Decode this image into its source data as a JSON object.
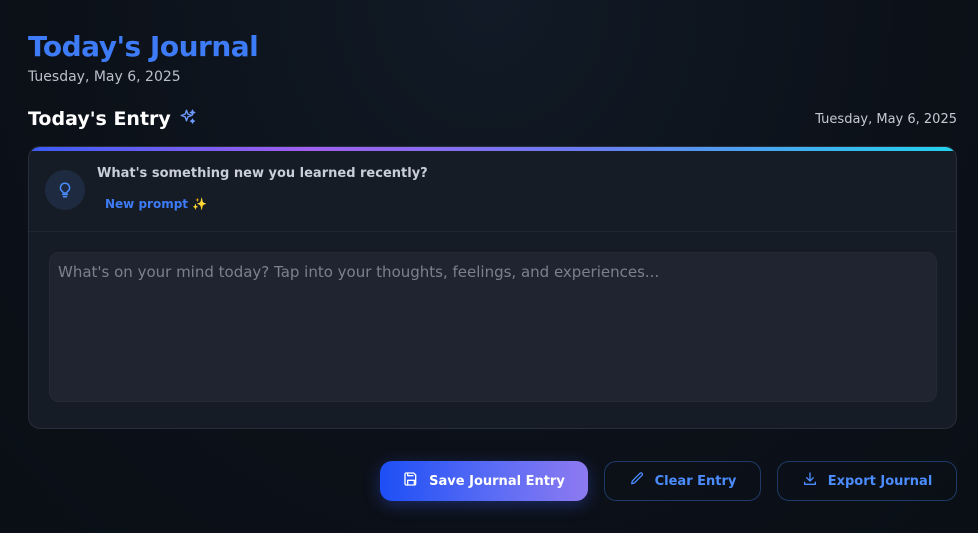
{
  "header": {
    "title": "Today's Journal",
    "date": "Tuesday, May 6, 2025"
  },
  "entry_section": {
    "title": "Today's Entry",
    "title_icon": "sparkles-icon",
    "date": "Tuesday, May 6, 2025"
  },
  "prompt": {
    "icon": "lightbulb-icon",
    "question": "What's something new you learned recently?",
    "new_prompt_label": "New prompt",
    "new_prompt_emoji": "✨"
  },
  "editor": {
    "value": "",
    "placeholder": "What's on your mind today? Tap into your thoughts, feelings, and experiences..."
  },
  "actions": {
    "save_label": "Save Journal Entry",
    "clear_label": "Clear Entry",
    "export_label": "Export Journal"
  },
  "colors": {
    "accent": "#3d7bf7",
    "background": "#0c1119",
    "card": "#161c26"
  }
}
